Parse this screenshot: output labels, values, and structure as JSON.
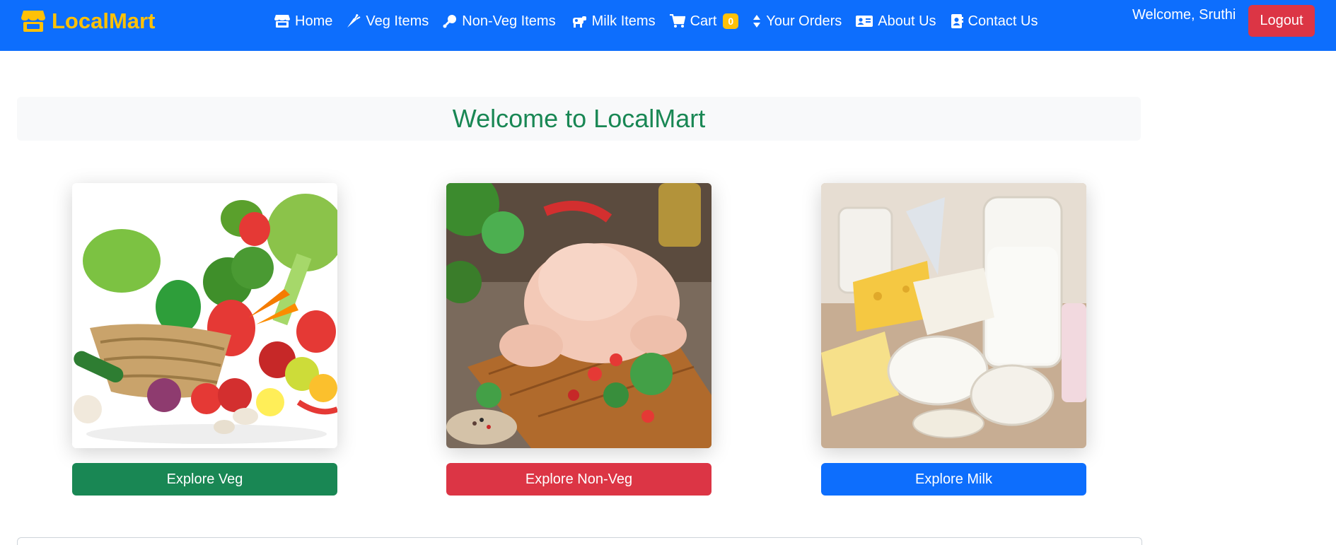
{
  "navbar": {
    "brand": "LocalMart",
    "links": [
      {
        "label": "Home",
        "icon": "store-icon"
      },
      {
        "label": "Veg Items",
        "icon": "carrot-icon"
      },
      {
        "label": "Non-Veg Items",
        "icon": "drumstick-icon"
      },
      {
        "label": "Milk Items",
        "icon": "cow-icon"
      },
      {
        "label": "Cart",
        "icon": "cart-icon",
        "badge": "0"
      },
      {
        "label": "Your Orders",
        "icon": "sort-icon"
      },
      {
        "label": "About Us",
        "icon": "id-card-icon"
      },
      {
        "label": "Contact Us",
        "icon": "address-book-icon"
      }
    ],
    "welcome": "Welcome, Sruthi",
    "logout": "Logout"
  },
  "hero": {
    "title": "Welcome to LocalMart"
  },
  "cards": [
    {
      "image": "vegetables-basket-photo",
      "button": "Explore Veg"
    },
    {
      "image": "raw-chicken-photo",
      "button": "Explore Non-Veg"
    },
    {
      "image": "dairy-products-photo",
      "button": "Explore Milk"
    }
  ],
  "colors": {
    "navbar": "#0d6efd",
    "brand": "#ffc107",
    "hero_title": "#198754",
    "veg_button": "#198754",
    "nonveg_button": "#dc3545",
    "milk_button": "#0d6efd",
    "logout_button": "#dc3545"
  }
}
